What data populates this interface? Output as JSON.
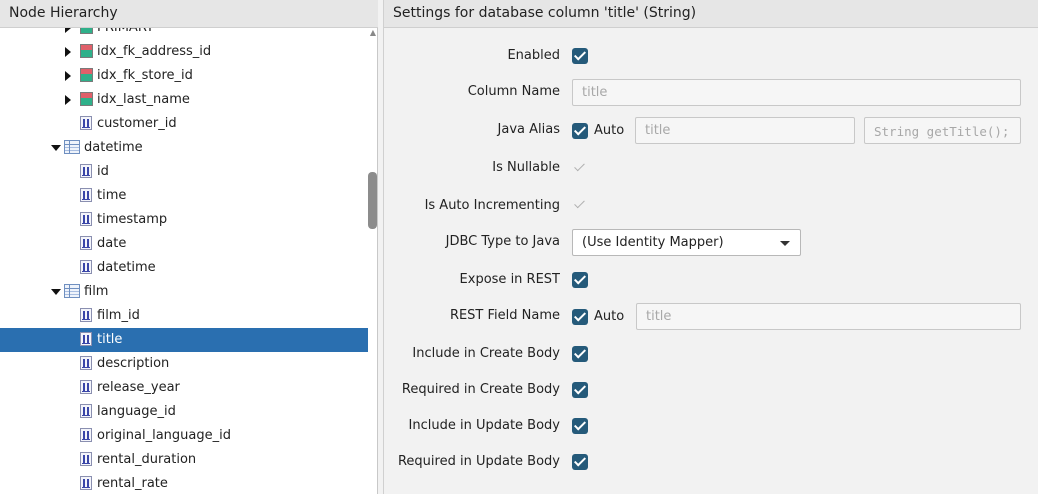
{
  "left_panel": {
    "title": "Node Hierarchy",
    "tree": [
      {
        "label": "PRIMARY",
        "icon": "index-icon",
        "toggle": "collapsed",
        "indent": 1,
        "partial": true
      },
      {
        "label": "idx_fk_address_id",
        "icon": "index-icon",
        "toggle": "collapsed",
        "indent": 1
      },
      {
        "label": "idx_fk_store_id",
        "icon": "index-icon",
        "toggle": "collapsed",
        "indent": 1
      },
      {
        "label": "idx_last_name",
        "icon": "index-icon",
        "toggle": "collapsed",
        "indent": 1
      },
      {
        "label": "customer_id",
        "icon": "column-icon",
        "toggle": "none",
        "indent": 1
      },
      {
        "label": "datetime",
        "icon": "table-icon",
        "toggle": "expanded",
        "indent": 0
      },
      {
        "label": "id",
        "icon": "column-icon",
        "toggle": "none",
        "indent": 1
      },
      {
        "label": "time",
        "icon": "column-icon",
        "toggle": "none",
        "indent": 1
      },
      {
        "label": "timestamp",
        "icon": "column-icon",
        "toggle": "none",
        "indent": 1
      },
      {
        "label": "date",
        "icon": "column-icon",
        "toggle": "none",
        "indent": 1
      },
      {
        "label": "datetime",
        "icon": "column-icon",
        "toggle": "none",
        "indent": 1
      },
      {
        "label": "film",
        "icon": "table-icon",
        "toggle": "expanded",
        "indent": 0
      },
      {
        "label": "film_id",
        "icon": "column-icon",
        "toggle": "none",
        "indent": 1
      },
      {
        "label": "title",
        "icon": "column-icon",
        "toggle": "none",
        "indent": 1,
        "selected": true
      },
      {
        "label": "description",
        "icon": "column-icon",
        "toggle": "none",
        "indent": 1
      },
      {
        "label": "release_year",
        "icon": "column-icon",
        "toggle": "none",
        "indent": 1
      },
      {
        "label": "language_id",
        "icon": "column-icon",
        "toggle": "none",
        "indent": 1
      },
      {
        "label": "original_language_id",
        "icon": "column-icon",
        "toggle": "none",
        "indent": 1
      },
      {
        "label": "rental_duration",
        "icon": "column-icon",
        "toggle": "none",
        "indent": 1
      },
      {
        "label": "rental_rate",
        "icon": "column-icon",
        "toggle": "none",
        "indent": 1
      }
    ]
  },
  "right_panel": {
    "title": "Settings for database column 'title' (String)",
    "enabled": {
      "label": "Enabled",
      "checked": true
    },
    "column_name": {
      "label": "Column Name",
      "placeholder": "title"
    },
    "java_alias": {
      "label": "Java Alias",
      "auto_label": "Auto",
      "auto_checked": true,
      "placeholder": "title",
      "getter_placeholder": "String getTitle();"
    },
    "is_nullable": {
      "label": "Is Nullable",
      "checked": true,
      "disabled": true
    },
    "is_auto_incrementing": {
      "label": "Is Auto Incrementing",
      "checked": true,
      "disabled": true
    },
    "jdbc_type": {
      "label": "JDBC Type to Java",
      "selected": "(Use Identity Mapper)"
    },
    "expose_rest": {
      "label": "Expose in REST",
      "checked": true
    },
    "rest_field_name": {
      "label": "REST Field Name",
      "auto_label": "Auto",
      "auto_checked": true,
      "placeholder": "title"
    },
    "include_create": {
      "label": "Include in Create Body",
      "checked": true
    },
    "required_create": {
      "label": "Required in Create Body",
      "checked": true
    },
    "include_update": {
      "label": "Include in Update Body",
      "checked": true
    },
    "required_update": {
      "label": "Required in Update Body",
      "checked": true
    }
  },
  "colors": {
    "selection": "#2a6fb0",
    "checkbox": "#255a7a"
  }
}
